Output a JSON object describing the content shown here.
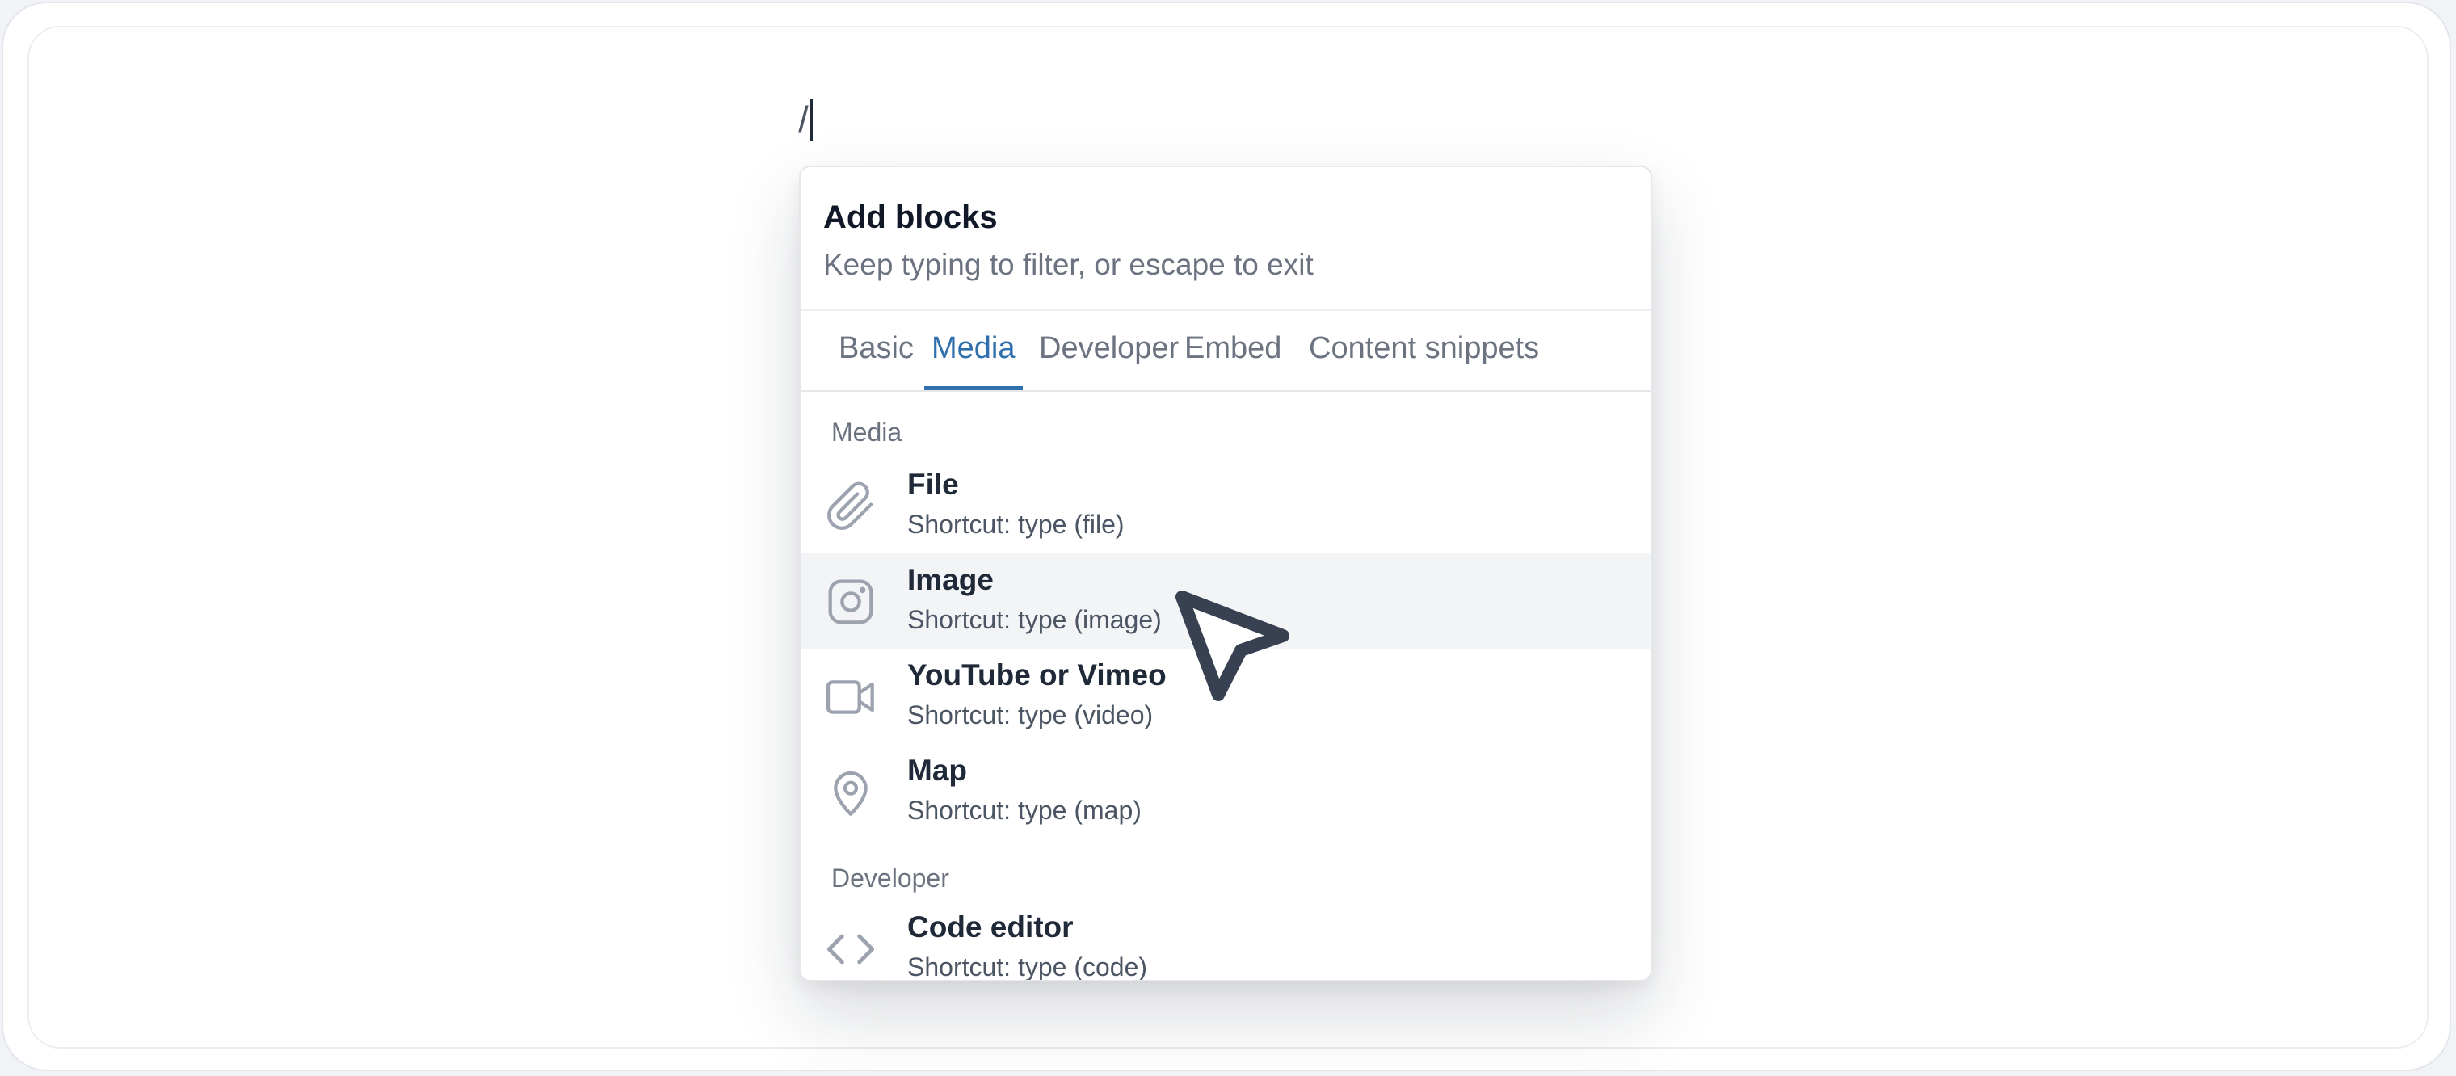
{
  "editor": {
    "typed_text": "/"
  },
  "popover": {
    "title": "Add blocks",
    "subtitle": "Keep typing to filter, or escape to exit",
    "tabs": [
      {
        "label": "Basic",
        "active": false
      },
      {
        "label": "Media",
        "active": true
      },
      {
        "label": "Developer",
        "active": false
      },
      {
        "label": "Embed",
        "active": false
      },
      {
        "label": "Content snippets",
        "active": false
      }
    ],
    "sections": [
      {
        "label": "Media",
        "items": [
          {
            "title": "File",
            "shortcut": "Shortcut: type (file)",
            "icon": "paperclip-icon"
          },
          {
            "title": "Image",
            "shortcut": "Shortcut: type (image)",
            "icon": "image-icon",
            "hovered": true
          },
          {
            "title": "YouTube or Vimeo",
            "shortcut": "Shortcut: type (video)",
            "icon": "video-camera-icon"
          },
          {
            "title": "Map",
            "shortcut": "Shortcut: type (map)",
            "icon": "map-pin-icon"
          }
        ]
      },
      {
        "label": "Developer",
        "items": [
          {
            "title": "Code editor",
            "shortcut": "Shortcut: type (code)",
            "icon": "code-icon"
          }
        ]
      }
    ]
  },
  "colors": {
    "accent": "#2f6fae",
    "hover_row": "#f3f4f6",
    "icon_gray": "#9ca3af",
    "cursor": "#374151"
  },
  "cursor_icon": "pointer-arrow-icon"
}
